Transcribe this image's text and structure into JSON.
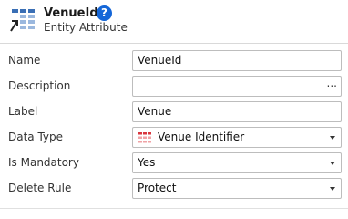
{
  "header": {
    "title": "VenueId",
    "help_glyph": "?",
    "subtitle": "Entity Attribute",
    "icon": "entity-attribute-icon"
  },
  "properties": [
    {
      "label": "Name",
      "value": "VenueId",
      "control": "text"
    },
    {
      "label": "Description",
      "value": "",
      "control": "text-ellipsis",
      "button_text": "..."
    },
    {
      "label": "Label",
      "value": "Venue",
      "control": "text"
    },
    {
      "label": "Data Type",
      "value": "Venue Identifier",
      "control": "dropdown",
      "icon": "entity-identifier-icon"
    },
    {
      "label": "Is Mandatory",
      "value": "Yes",
      "control": "dropdown"
    },
    {
      "label": "Delete Rule",
      "value": "Protect",
      "control": "dropdown"
    }
  ],
  "colors": {
    "help_badge": "#1466d8",
    "identifier_icon": "#d9363e",
    "border": "#bdbdbd"
  }
}
